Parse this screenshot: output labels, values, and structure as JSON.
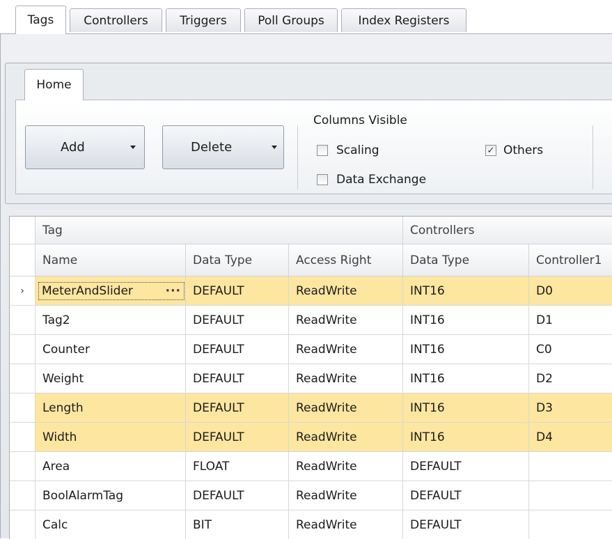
{
  "tabs": [
    "Tags",
    "Controllers",
    "Triggers",
    "Poll Groups",
    "Index Registers"
  ],
  "ribbon": {
    "tab": "Home",
    "add_label": "Add",
    "delete_label": "Delete",
    "columns_title": "Columns Visible",
    "checkboxes": [
      {
        "label": "Scaling",
        "checked": false
      },
      {
        "label": "Data Exchange",
        "checked": false
      },
      {
        "label": "Others",
        "checked": true
      }
    ]
  },
  "grid": {
    "groups": [
      "Tag",
      "Controllers"
    ],
    "columns": [
      "Name",
      "Data Type",
      "Access Right",
      "Data Type",
      "Controller1"
    ],
    "rows": [
      [
        "MeterAndSlider",
        "DEFAULT",
        "ReadWrite",
        "INT16",
        "D0"
      ],
      [
        "Tag2",
        "DEFAULT",
        "ReadWrite",
        "INT16",
        "D1"
      ],
      [
        "Counter",
        "DEFAULT",
        "ReadWrite",
        "INT16",
        "C0"
      ],
      [
        "Weight",
        "DEFAULT",
        "ReadWrite",
        "INT16",
        "D2"
      ],
      [
        "Length",
        "DEFAULT",
        "ReadWrite",
        "INT16",
        "D3"
      ],
      [
        "Width",
        "DEFAULT",
        "ReadWrite",
        "INT16",
        "D4"
      ],
      [
        "Area",
        "FLOAT",
        "ReadWrite",
        "DEFAULT",
        ""
      ],
      [
        "BoolAlarmTag",
        "DEFAULT",
        "ReadWrite",
        "DEFAULT",
        ""
      ],
      [
        "Calc",
        "BIT",
        "ReadWrite",
        "DEFAULT",
        ""
      ]
    ],
    "selected_rows": [
      0,
      4,
      5
    ],
    "current_row": 0,
    "ellipsis": "···",
    "row_indicator": "›"
  },
  "colors": {
    "selection": "#fde6a0",
    "panel": "#e9ecef"
  }
}
